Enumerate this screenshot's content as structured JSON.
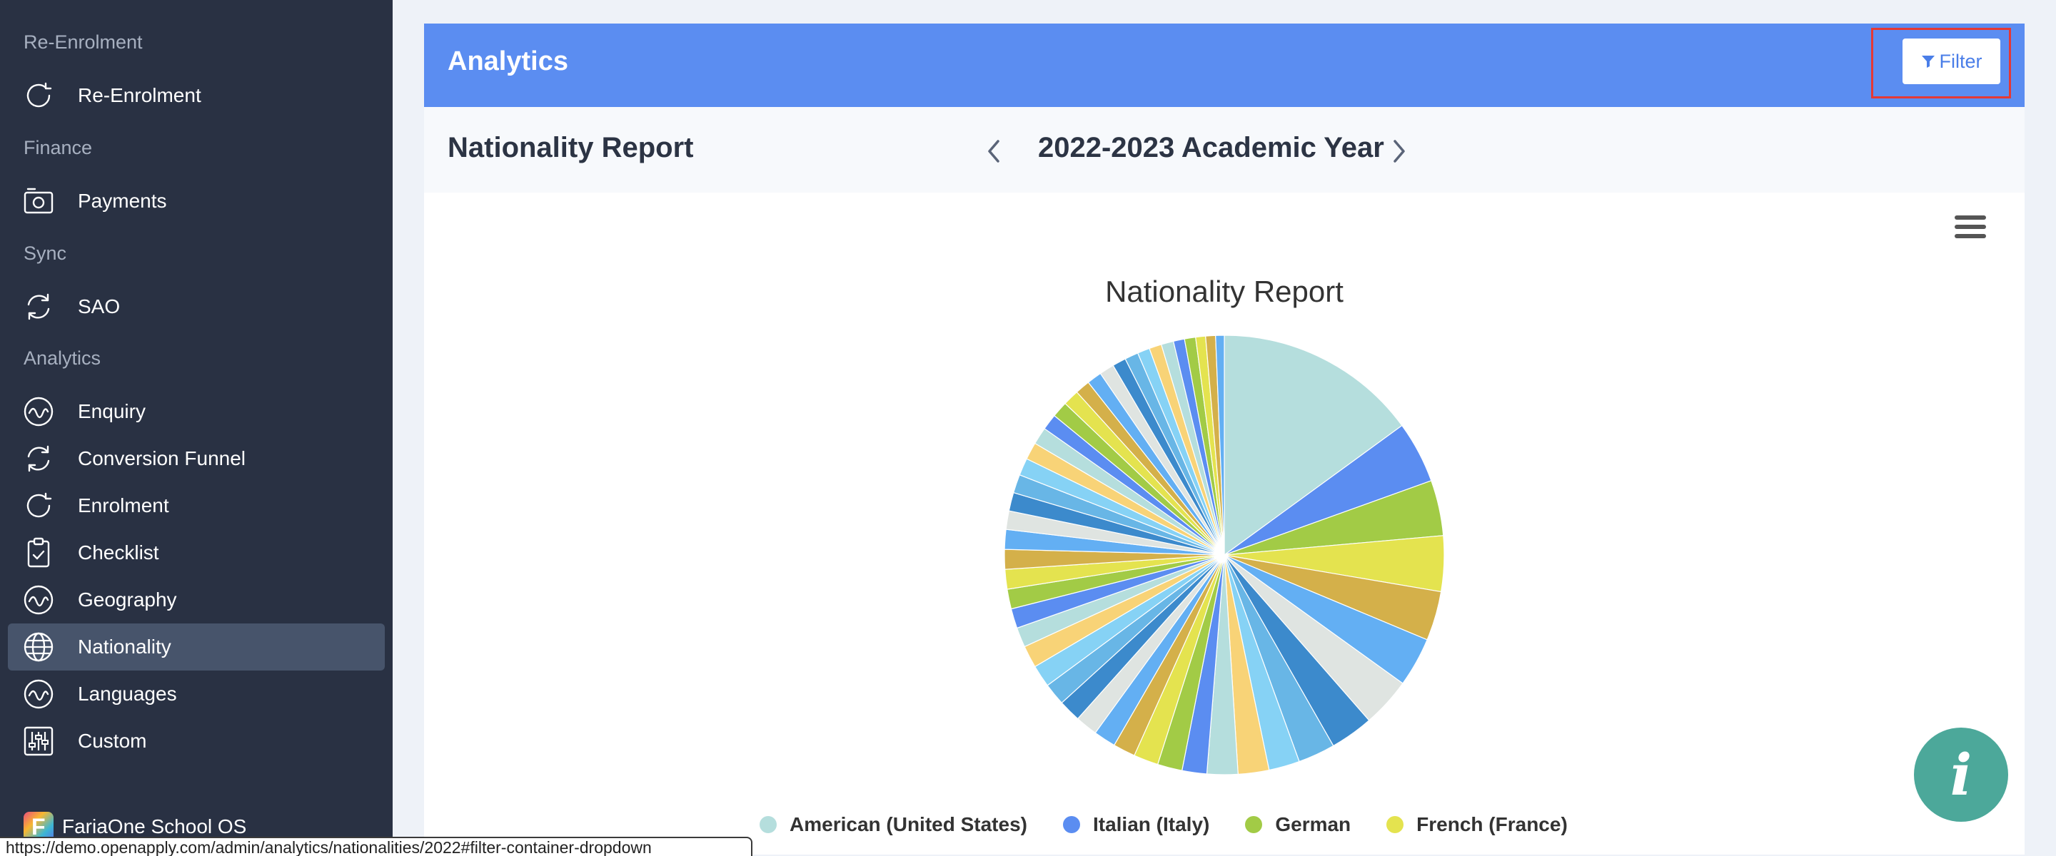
{
  "sidebar": {
    "sections": [
      {
        "label": "Re-Enrolment",
        "items": [
          {
            "label": "Re-Enrolment",
            "icon": "refresh-icon"
          }
        ]
      },
      {
        "label": "Finance",
        "items": [
          {
            "label": "Payments",
            "icon": "camera-icon"
          }
        ]
      },
      {
        "label": "Sync",
        "items": [
          {
            "label": "SAO",
            "icon": "sync-icon"
          }
        ]
      },
      {
        "label": "Analytics",
        "items": [
          {
            "label": "Enquiry",
            "icon": "wave-icon"
          },
          {
            "label": "Conversion Funnel",
            "icon": "sync-icon"
          },
          {
            "label": "Enrolment",
            "icon": "refresh-icon"
          },
          {
            "label": "Checklist",
            "icon": "clipboard-check-icon"
          },
          {
            "label": "Geography",
            "icon": "wave-icon"
          },
          {
            "label": "Nationality",
            "icon": "globe-icon",
            "active": true
          },
          {
            "label": "Languages",
            "icon": "wave-icon"
          },
          {
            "label": "Custom",
            "icon": "sliders-icon"
          }
        ]
      }
    ],
    "brand": "FariaOne School OS",
    "brand_logo_letter": "F"
  },
  "status_url": "https://demo.openapply.com/admin/analytics/nationalities/2022#filter-container-dropdown",
  "header": {
    "title": "Analytics",
    "filter_label": "Filter",
    "accent": "#5b8df1"
  },
  "subheader": {
    "report_title": "Nationality Report",
    "year_label": "2022-2023 Academic Year"
  },
  "chart_data": {
    "type": "pie",
    "title": "Nationality Report",
    "palette": [
      "#b5dedd",
      "#5b8df1",
      "#a2cb46",
      "#e4e34f",
      "#d4b04a",
      "#63aff3",
      "#dfe4e1",
      "#3c8acc",
      "#68b6e6",
      "#86d2f5",
      "#f8d377"
    ],
    "slices": [
      {
        "name": "American (United States)",
        "value": 16.5,
        "color": "#b5dedd"
      },
      {
        "name": "Italian (Italy)",
        "value": 5.0,
        "color": "#5b8df1"
      },
      {
        "name": "German",
        "value": 4.5,
        "color": "#a2cb46"
      },
      {
        "name": "French (France)",
        "value": 4.5,
        "color": "#e4e34f"
      },
      {
        "value": 4.0,
        "color": "#d4b04a"
      },
      {
        "value": 4.0,
        "color": "#63aff3"
      },
      {
        "value": 4.0,
        "color": "#dfe4e1"
      },
      {
        "value": 3.5,
        "color": "#3c8acc"
      },
      {
        "value": 3.0,
        "color": "#68b6e6"
      },
      {
        "value": 2.5,
        "color": "#86d2f5"
      },
      {
        "value": 2.5,
        "color": "#f8d377"
      },
      {
        "value": 2.5,
        "color": "#b5dedd"
      },
      {
        "value": 2.0,
        "color": "#5b8df1"
      },
      {
        "value": 2.0,
        "color": "#a2cb46"
      },
      {
        "value": 2.0,
        "color": "#e4e34f"
      },
      {
        "value": 1.8,
        "color": "#d4b04a"
      },
      {
        "value": 1.8,
        "color": "#63aff3"
      },
      {
        "value": 1.8,
        "color": "#dfe4e1"
      },
      {
        "value": 1.8,
        "color": "#3c8acc"
      },
      {
        "value": 1.8,
        "color": "#68b6e6"
      },
      {
        "value": 1.8,
        "color": "#86d2f5"
      },
      {
        "value": 1.8,
        "color": "#f8d377"
      },
      {
        "value": 1.6,
        "color": "#b5dedd"
      },
      {
        "value": 1.6,
        "color": "#5b8df1"
      },
      {
        "value": 1.6,
        "color": "#a2cb46"
      },
      {
        "value": 1.6,
        "color": "#e4e34f"
      },
      {
        "value": 1.6,
        "color": "#d4b04a"
      },
      {
        "value": 1.6,
        "color": "#63aff3"
      },
      {
        "value": 1.5,
        "color": "#dfe4e1"
      },
      {
        "value": 1.5,
        "color": "#3c8acc"
      },
      {
        "value": 1.5,
        "color": "#68b6e6"
      },
      {
        "value": 1.4,
        "color": "#86d2f5"
      },
      {
        "value": 1.4,
        "color": "#f8d377"
      },
      {
        "value": 1.4,
        "color": "#b5dedd"
      },
      {
        "value": 1.3,
        "color": "#5b8df1"
      },
      {
        "value": 1.3,
        "color": "#a2cb46"
      },
      {
        "value": 1.3,
        "color": "#e4e34f"
      },
      {
        "value": 1.2,
        "color": "#d4b04a"
      },
      {
        "value": 1.2,
        "color": "#63aff3"
      },
      {
        "value": 1.2,
        "color": "#dfe4e1"
      },
      {
        "value": 1.1,
        "color": "#3c8acc"
      },
      {
        "value": 1.1,
        "color": "#68b6e6"
      },
      {
        "value": 1.0,
        "color": "#86d2f5"
      },
      {
        "value": 1.0,
        "color": "#f8d377"
      },
      {
        "value": 1.0,
        "color": "#b5dedd"
      },
      {
        "value": 0.9,
        "color": "#5b8df1"
      },
      {
        "value": 0.9,
        "color": "#a2cb46"
      },
      {
        "value": 0.8,
        "color": "#e4e34f"
      },
      {
        "value": 0.8,
        "color": "#d4b04a"
      },
      {
        "value": 0.7,
        "color": "#63aff3"
      }
    ],
    "legend": [
      {
        "name": "American (United States)",
        "color": "#b5dedd"
      },
      {
        "name": "Italian (Italy)",
        "color": "#5b8df1"
      },
      {
        "name": "German",
        "color": "#a2cb46"
      },
      {
        "name": "French (France)",
        "color": "#e4e34f"
      }
    ],
    "legend_position": "bottom"
  },
  "info_button": {
    "glyph": "i",
    "color": "#4ca89a"
  }
}
